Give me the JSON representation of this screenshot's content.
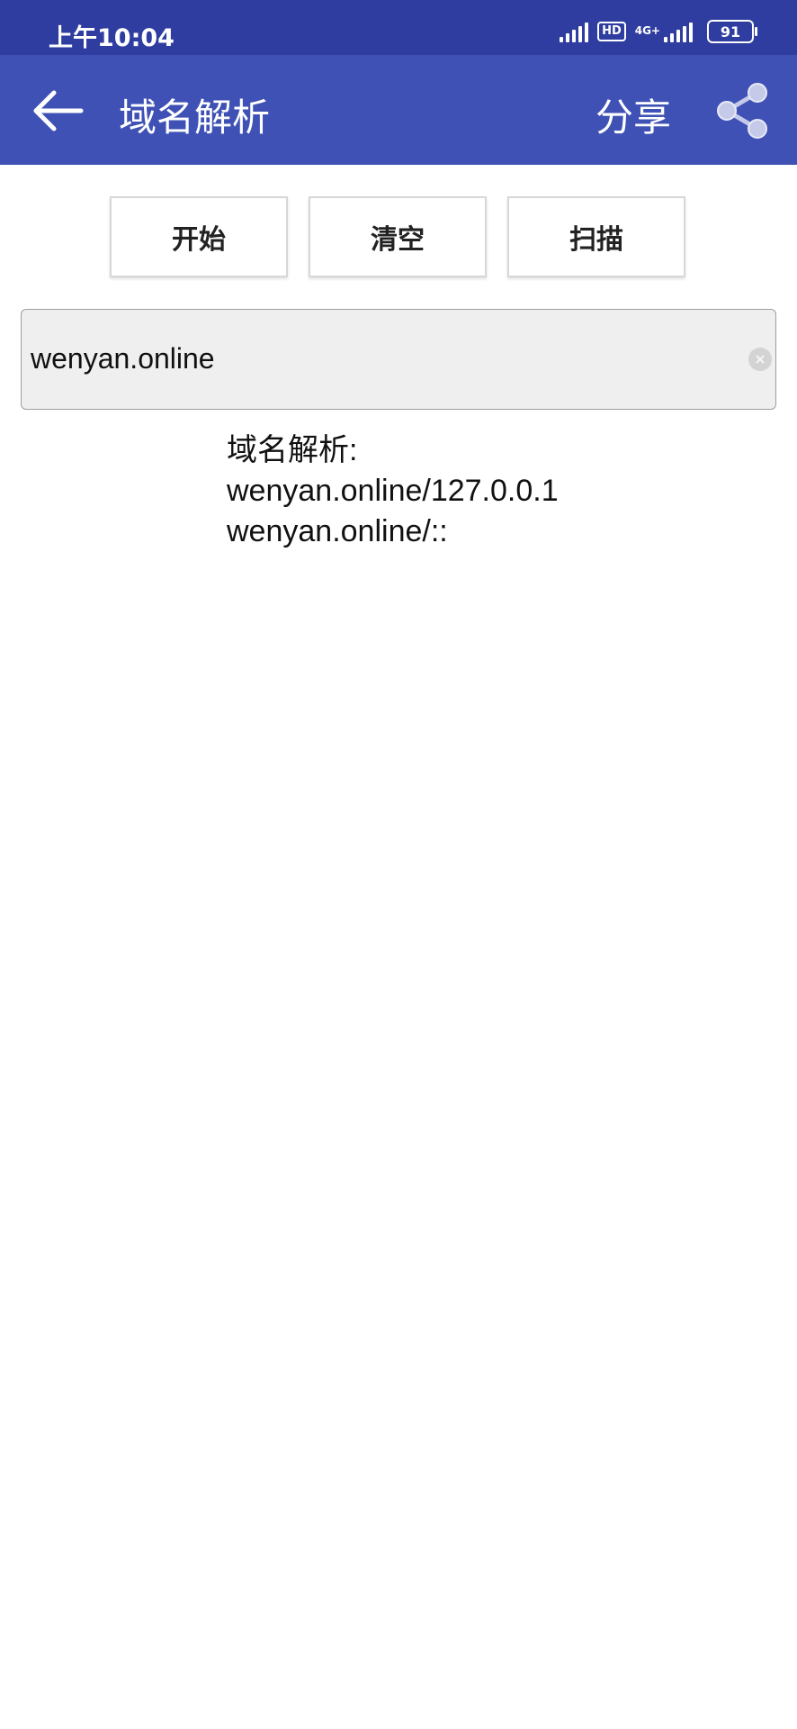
{
  "status_bar": {
    "time": "上午10:04",
    "hd": "HD",
    "network": "4G+",
    "battery": "91"
  },
  "app_bar": {
    "title": "域名解析",
    "share_label": "分享"
  },
  "buttons": {
    "start": "开始",
    "clear": "清空",
    "scan": "扫描"
  },
  "input": {
    "value": "wenyan.online"
  },
  "results": {
    "header": "域名解析:",
    "lines": [
      "wenyan.online/127.0.0.1",
      "wenyan.online/::"
    ]
  },
  "colors": {
    "status_bar": "#2e3d9f",
    "app_bar": "#3f51b5"
  }
}
